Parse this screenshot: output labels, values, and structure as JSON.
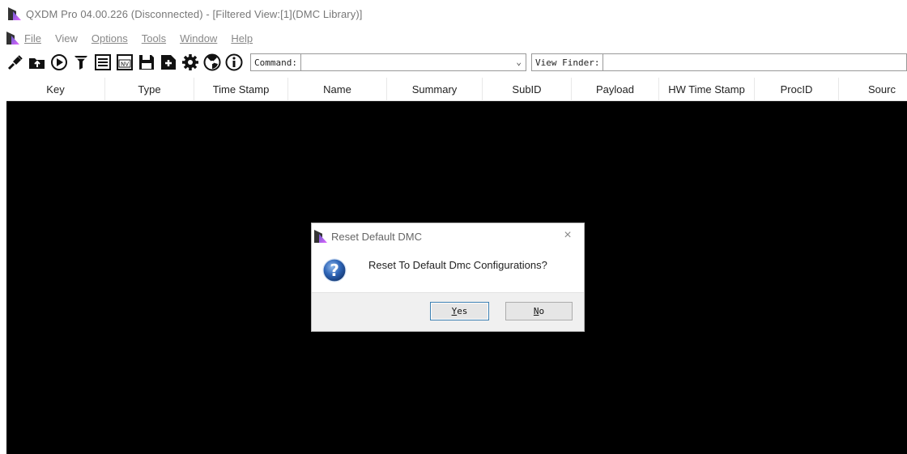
{
  "window": {
    "title": "QXDM Pro 04.00.226 (Disconnected) - [Filtered View:[1](DMC Library)]"
  },
  "menu": [
    "File",
    "View",
    "Options",
    "Tools",
    "Window",
    "Help"
  ],
  "toolbar": {
    "icons": [
      "connect-icon",
      "open-folder-icon",
      "play-icon",
      "filter-icon",
      "list-icon",
      "nv-icon",
      "save-icon",
      "add-icon",
      "gear-icon",
      "radiation-icon",
      "info-icon"
    ],
    "nv_text": "NV",
    "command_label": "Command:",
    "command_value": "",
    "view_finder_label": "View Finder:",
    "view_finder_value": ""
  },
  "columns": [
    "Key",
    "Type",
    "Time Stamp",
    "Name",
    "Summary",
    "SubID",
    "Payload",
    "HW Time Stamp",
    "ProcID",
    "Sourc"
  ],
  "dialog": {
    "title": "Reset Default DMC",
    "close": "×",
    "message": "Reset To Default Dmc Configurations?",
    "icon_glyph": "?",
    "yes_label": "Yes",
    "no_label": "No"
  },
  "colors": {
    "log_background": "#000000",
    "dialog_footer": "#f0f0f0",
    "default_button_border": "#3c7fb1"
  }
}
